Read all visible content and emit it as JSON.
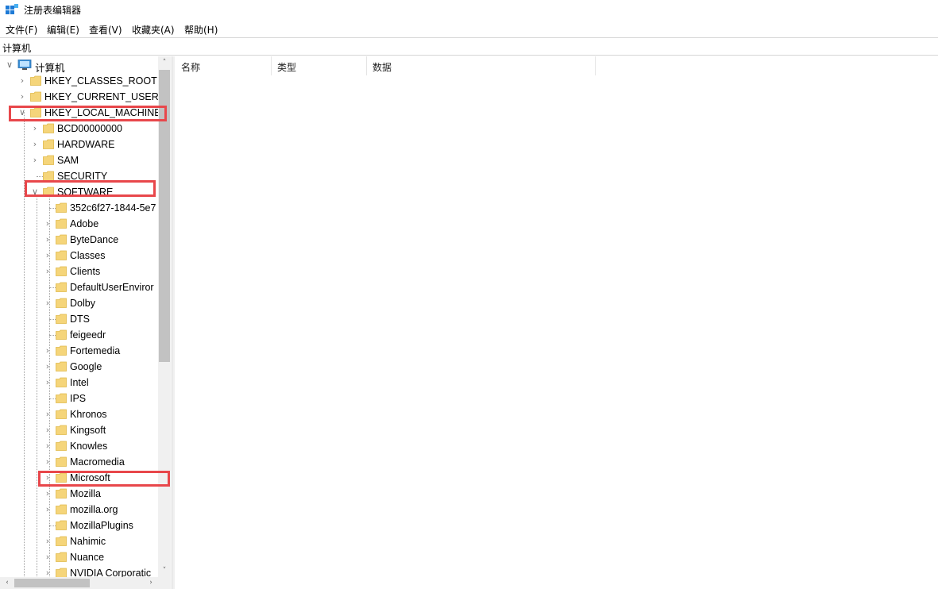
{
  "window": {
    "title": "注册表编辑器"
  },
  "menu": [
    {
      "label": "文件(F)"
    },
    {
      "label": "编辑(E)"
    },
    {
      "label": "查看(V)"
    },
    {
      "label": "收藏夹(A)"
    },
    {
      "label": "帮助(H)"
    }
  ],
  "address": {
    "path": "计算机"
  },
  "tree": {
    "root_label": "计算机",
    "hives": [
      {
        "label": "HKEY_CLASSES_ROOT",
        "state": "collapsed"
      },
      {
        "label": "HKEY_CURRENT_USER",
        "state": "collapsed"
      },
      {
        "label": "HKEY_LOCAL_MACHINE",
        "state": "expanded"
      }
    ],
    "hklm_children": [
      {
        "label": "BCD00000000",
        "state": "collapsed"
      },
      {
        "label": "HARDWARE",
        "state": "collapsed"
      },
      {
        "label": "SAM",
        "state": "collapsed"
      },
      {
        "label": "SECURITY",
        "state": "leaf"
      },
      {
        "label": "SOFTWARE",
        "state": "expanded"
      }
    ],
    "software_children": [
      {
        "label": "352c6f27-1844-5e7",
        "state": "leaf"
      },
      {
        "label": "Adobe",
        "state": "collapsed"
      },
      {
        "label": "ByteDance",
        "state": "collapsed"
      },
      {
        "label": "Classes",
        "state": "collapsed"
      },
      {
        "label": "Clients",
        "state": "collapsed"
      },
      {
        "label": "DefaultUserEnviror",
        "state": "leaf"
      },
      {
        "label": "Dolby",
        "state": "collapsed"
      },
      {
        "label": "DTS",
        "state": "leaf"
      },
      {
        "label": "feigeedr",
        "state": "leaf"
      },
      {
        "label": "Fortemedia",
        "state": "collapsed"
      },
      {
        "label": "Google",
        "state": "collapsed"
      },
      {
        "label": "Intel",
        "state": "collapsed"
      },
      {
        "label": "IPS",
        "state": "leaf"
      },
      {
        "label": "Khronos",
        "state": "collapsed"
      },
      {
        "label": "Kingsoft",
        "state": "collapsed"
      },
      {
        "label": "Knowles",
        "state": "collapsed"
      },
      {
        "label": "Macromedia",
        "state": "collapsed"
      },
      {
        "label": "Microsoft",
        "state": "collapsed"
      },
      {
        "label": "Mozilla",
        "state": "collapsed"
      },
      {
        "label": "mozilla.org",
        "state": "collapsed"
      },
      {
        "label": "MozillaPlugins",
        "state": "leaf"
      },
      {
        "label": "Nahimic",
        "state": "collapsed"
      },
      {
        "label": "Nuance",
        "state": "collapsed"
      },
      {
        "label": "NVIDIA Corporatic",
        "state": "collapsed"
      }
    ]
  },
  "list": {
    "columns": [
      {
        "label": "名称"
      },
      {
        "label": "类型"
      },
      {
        "label": "数据"
      }
    ]
  },
  "colors": {
    "highlight": "#e8474b",
    "folder": "#f5d57a",
    "folder_edge": "#e0b94a",
    "computer_icon": "#3a8fd6"
  },
  "icons": {
    "expanded": "chevron-down-icon",
    "collapsed": "chevron-right-icon",
    "folder": "folder-icon",
    "computer": "computer-icon"
  }
}
